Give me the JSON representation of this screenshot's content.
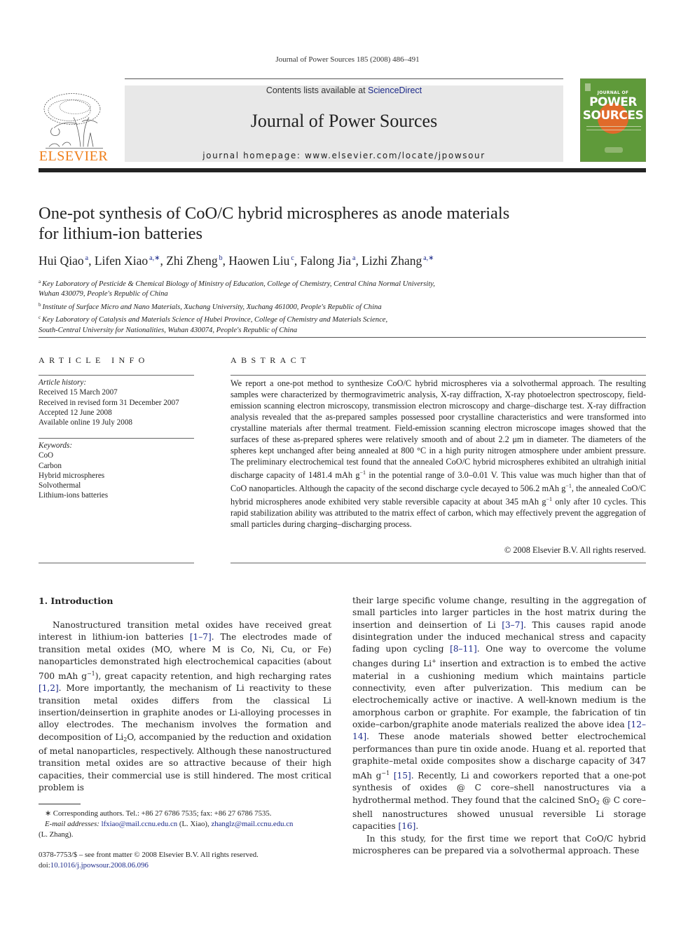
{
  "running_head": "Journal of Power Sources 185 (2008) 486–491",
  "publisher": {
    "logo_text": "ELSEVIER",
    "brand_color": "#ef7f1a"
  },
  "banner": {
    "contents_prefix": "Contents lists available at ",
    "contents_link": "ScienceDirect",
    "journal_title": "Journal of Power Sources",
    "homepage": "journal homepage: www.elsevier.com/locate/jpowsour"
  },
  "cover": {
    "top_text": "JOURNAL OF",
    "big_line1": "POWER",
    "big_line2": "SOURCES",
    "bg_color": "#5f9a3a",
    "accent_color": "#e06a2a"
  },
  "article": {
    "title_line1": "One-pot synthesis of CoO/C hybrid microspheres as anode materials",
    "title_line2": "for lithium-ion batteries",
    "authors": [
      {
        "name": "Hui Qiao",
        "sup": "a",
        "sep": ", "
      },
      {
        "name": "Lifen Xiao",
        "sup": "a,∗",
        "sep": ", "
      },
      {
        "name": "Zhi Zheng",
        "sup": "b",
        "sep": ", "
      },
      {
        "name": "Haowen Liu",
        "sup": "c",
        "sep": ", "
      },
      {
        "name": "Falong Jia",
        "sup": "a",
        "sep": ", "
      },
      {
        "name": "Lizhi Zhang",
        "sup": "a,∗",
        "sep": ""
      }
    ],
    "affiliations": [
      {
        "mark": "a",
        "line1": "Key Laboratory of Pesticide & Chemical Biology of Ministry of Education, College of Chemistry, Central China Normal University,",
        "line2": "Wuhan 430079, People's Republic of China"
      },
      {
        "mark": "b",
        "line1": "Institute of Surface Micro and Nano Materials, Xuchang University, Xuchang 461000, People's Republic of China",
        "line2": ""
      },
      {
        "mark": "c",
        "line1": "Key Laboratory of Catalysis and Materials Science of Hubei Province, College of Chemistry and Materials Science,",
        "line2": "South-Central University for Nationalities, Wuhan 430074, People's Republic of China"
      }
    ]
  },
  "article_info": {
    "heading": "ARTICLE INFO",
    "history_label": "Article history:",
    "history": [
      "Received 15 March 2007",
      "Received in revised form 31 December 2007",
      "Accepted 12 June 2008",
      "Available online 19 July 2008"
    ],
    "keywords_label": "Keywords:",
    "keywords": [
      "CoO",
      "Carbon",
      "Hybrid microspheres",
      "Solvothermal",
      "Lithium-ions batteries"
    ]
  },
  "abstract": {
    "heading": "ABSTRACT",
    "p1": "We report a one-pot method to synthesize CoO/C hybrid microspheres via a solvothermal approach. The resulting samples were characterized by thermogravimetric analysis, X-ray diffraction, X-ray photoelectron spectroscopy, field-emission scanning electron microscopy, transmission electron microscopy and charge–discharge test. X-ray diffraction analysis revealed that the as-prepared samples possessed poor crystalline characteristics and were transformed into crystalline materials after thermal treatment. Field-emission scanning electron microscope images showed that the surfaces of these as-prepared spheres were relatively smooth and of about 2.2 μm in diameter. The diameters of the spheres kept unchanged after being annealed at 800 °C in a high purity nitrogen atmosphere under ambient pressure. The preliminary electrochemical test found that the annealed CoO/C hybrid microspheres exhibited an ultrahigh initial discharge capacity of 1481.4 mAh g",
    "p2": " in the potential range of 3.0–0.01 V. This value was much higher than that of CoO nanoparticles. Although the capacity of the second discharge cycle decayed to 506.2 mAh g",
    "p3": ", the annealed CoO/C hybrid microspheres anode exhibited very stable reversible capacity at about 345 mAh g",
    "p4": " only after 10 cycles. This rapid stabilization ability was attributed to the matrix effect of carbon, which may effectively prevent the aggregation of small particles during charging–discharging process.",
    "exp": "−1",
    "copyright": "© 2008 Elsevier B.V. All rights reserved."
  },
  "intro": {
    "heading": "1.  Introduction",
    "left": {
      "a": "Nanostructured transition metal oxides have received great interest in lithium-ion batteries ",
      "ref1": "[1–7]",
      "b": ". The electrodes made of transition metal oxides (MO, where M is Co, Ni, Cu, or Fe) nanoparticles demonstrated high electrochemical capacities (about 700 mAh g",
      "exp": "−1",
      "c": "), great capacity retention, and high recharging rates ",
      "ref2": "[1,2]",
      "d": ". More importantly, the mechanism of Li reactivity to these transition metal oxides differs from the classical Li insertion/deinsertion in graphite anodes or Li-alloying processes in alloy electrodes. The mechanism involves the formation and decomposition of Li",
      "sub": "2",
      "e": "O, accompanied by the reduction and oxidation of metal nanoparticles, respectively. Although these nanostructured transition metal oxides are so attractive because of their high capacities, their commercial use is still hindered. The most critical problem is"
    },
    "right": {
      "a": "their large specific volume change, resulting in the aggregation of small particles into larger particles in the host matrix during the insertion and deinsertion of Li ",
      "ref1": "[3–7]",
      "b": ". This causes rapid anode disintegration under the induced mechanical stress and capacity fading upon cycling ",
      "ref2": "[8–11]",
      "c": ". One way to overcome the volume changes during Li",
      "sup": "+",
      "d": " insertion and extraction is to embed the active material in a cushioning medium which maintains particle connectivity, even after pulverization. This medium can be electrochemically active or inactive. A well-known medium is the amorphous carbon or graphite. For example, the fabrication of tin oxide–carbon/graphite anode materials realized the above idea ",
      "ref3": "[12–14]",
      "e": ". These anode materials showed better electrochemical performances than pure tin oxide anode. Huang et al. reported that graphite–metal oxide composites show a discharge capacity of 347 mAh g",
      "exp": "−1",
      "f": " ",
      "ref4": "[15]",
      "g": ". Recently, Li and coworkers reported that a one-pot synthesis of oxides @ C core–shell nanostructures via a hydrothermal method. They found that the calcined SnO",
      "sub": "2",
      "h": " @ C core–shell nanostructures showed unusual reversible Li storage capacities ",
      "ref5": "[16]",
      "i": ".",
      "p2": "In this study, for the first time we report that CoO/C hybrid microspheres can be prepared via a solvothermal approach. These"
    }
  },
  "footnotes": {
    "corresponding": "∗  Corresponding authors. Tel.: +86 27 6786 7535; fax: +86 27 6786 7535.",
    "email_label": "E-mail addresses: ",
    "email1": "lfxiao@mail.ccnu.edu.cn",
    "email1_who": " (L. Xiao), ",
    "email2": "zhanglz@mail.ccnu.edu.cn",
    "email2_who": "(L. Zhang).",
    "issn": "0378-7753/$ – see front matter © 2008 Elsevier B.V. All rights reserved.",
    "doi_label": "doi:",
    "doi": "10.1016/j.jpowsour.2008.06.096"
  }
}
